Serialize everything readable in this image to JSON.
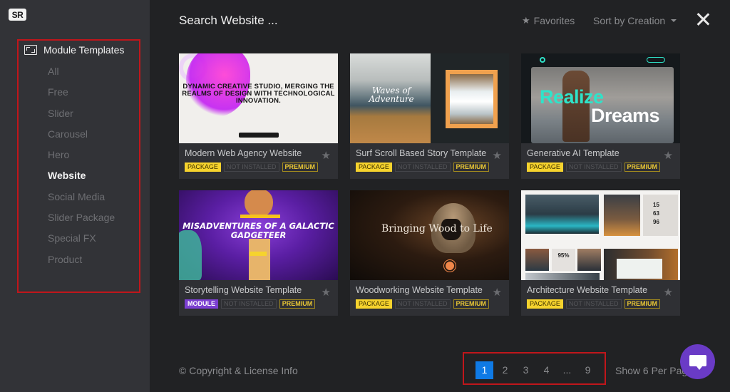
{
  "sidebar": {
    "logo": "SR",
    "category_title": "Module Templates",
    "category_icon": "module-templates-icon",
    "items": [
      {
        "label": "All",
        "active": false
      },
      {
        "label": "Free",
        "active": false
      },
      {
        "label": "Slider",
        "active": false
      },
      {
        "label": "Carousel",
        "active": false
      },
      {
        "label": "Hero",
        "active": false
      },
      {
        "label": "Website",
        "active": true
      },
      {
        "label": "Social Media",
        "active": false
      },
      {
        "label": "Slider Package",
        "active": false
      },
      {
        "label": "Special FX",
        "active": false
      },
      {
        "label": "Product",
        "active": false
      }
    ]
  },
  "header": {
    "search_placeholder": "Search Website ...",
    "favorites_label": "Favorites",
    "favorites_icon": "star-icon",
    "sort_label": "Sort by Creation",
    "close_icon": "close-icon"
  },
  "templates": [
    {
      "title": "Modern Web Agency Website",
      "type_badge": "PACKAGE",
      "status_badge": "NOT INSTALLED",
      "tier_badge": "PREMIUM",
      "thumb_text": "DYNAMIC CREATIVE STUDIO, MERGING THE REALMS OF DESIGN WITH TECHNOLOGICAL INNOVATION."
    },
    {
      "title": "Surf Scroll Based Story Template",
      "type_badge": "PACKAGE",
      "status_badge": "NOT INSTALLED",
      "tier_badge": "PREMIUM",
      "thumb_text": "Waves of Adventure"
    },
    {
      "title": "Generative AI Template",
      "type_badge": "PACKAGE",
      "status_badge": "NOT INSTALLED",
      "tier_badge": "PREMIUM",
      "thumb_text_1": "Realize",
      "thumb_text_2": "Dreams"
    },
    {
      "title": "Storytelling Website Template",
      "type_badge": "MODULE",
      "status_badge": "NOT INSTALLED",
      "tier_badge": "PREMIUM",
      "thumb_text": "MISADVENTURES OF A GALACTIC GADGETEER"
    },
    {
      "title": "Woodworking Website Template",
      "type_badge": "PACKAGE",
      "status_badge": "NOT INSTALLED",
      "tier_badge": "PREMIUM",
      "thumb_text": "Bringing Wood to Life"
    },
    {
      "title": "Architecture Website Template",
      "type_badge": "PACKAGE",
      "status_badge": "NOT INSTALLED",
      "tier_badge": "PREMIUM",
      "thumb_stats": [
        "15",
        "63",
        "96"
      ],
      "thumb_percent": "95%"
    }
  ],
  "footer": {
    "copyright": "© Copyright & License Info",
    "pages": [
      "1",
      "2",
      "3",
      "4",
      "...",
      "9"
    ],
    "current_page": "1",
    "per_page": "Show 6 Per Page"
  },
  "colors": {
    "accent_blue": "#0f7ae5",
    "package_yellow": "#f6d32d",
    "module_purple": "#7b3fd1",
    "chat_purple": "#6a3bc6",
    "highlight_red": "#c0161b"
  }
}
